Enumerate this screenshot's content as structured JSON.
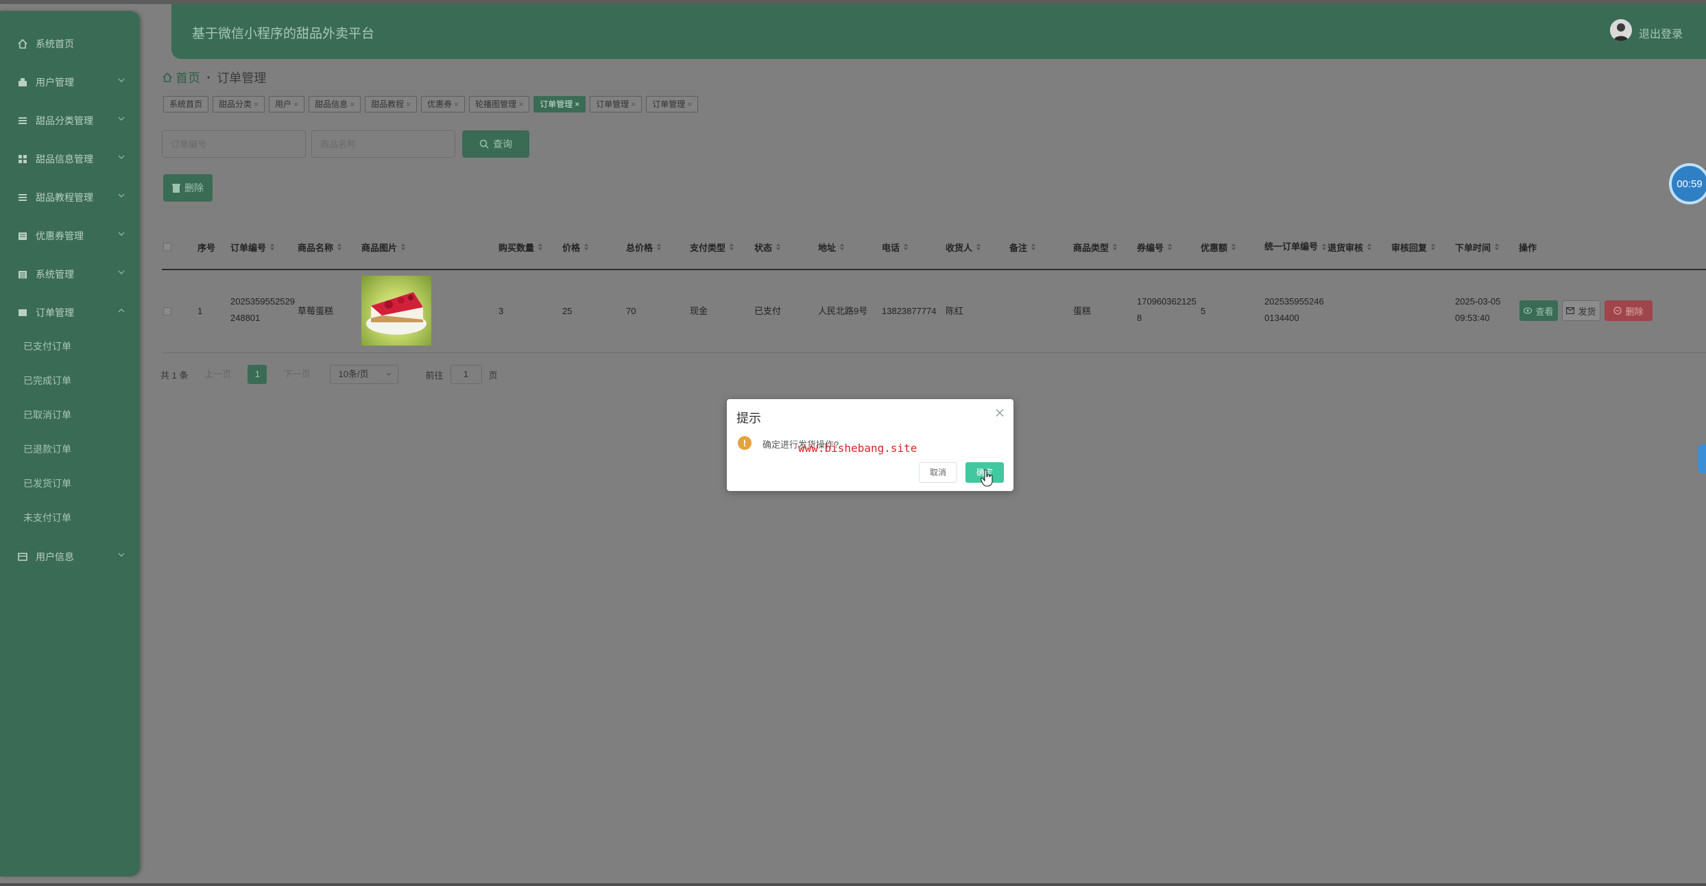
{
  "header": {
    "title": "基于微信小程序的甜品外卖平台",
    "logout": "退出登录"
  },
  "sidebar": {
    "items": [
      {
        "label": "系统首页",
        "icon": "home-icon"
      },
      {
        "label": "用户管理",
        "icon": "user-icon"
      },
      {
        "label": "甜品分类管理",
        "icon": "list-icon"
      },
      {
        "label": "甜品信息管理",
        "icon": "grid-icon"
      },
      {
        "label": "甜品教程管理",
        "icon": "list-icon"
      },
      {
        "label": "优惠券管理",
        "icon": "coupon-icon"
      },
      {
        "label": "系统管理",
        "icon": "settings-icon"
      },
      {
        "label": "订单管理",
        "icon": "order-icon"
      }
    ],
    "order_sub": [
      "已支付订单",
      "已完成订单",
      "已取消订单",
      "已退款订单",
      "已发货订单",
      "未支付订单"
    ],
    "last": {
      "label": "用户信息",
      "icon": "user-info-icon"
    }
  },
  "breadcrumb": {
    "home": "首页",
    "current": "订单管理"
  },
  "tabs": [
    {
      "label": "系统首页",
      "closable": false,
      "active": false
    },
    {
      "label": "甜品分类",
      "closable": true,
      "active": false
    },
    {
      "label": "用户",
      "closable": true,
      "active": false
    },
    {
      "label": "甜品信息",
      "closable": true,
      "active": false
    },
    {
      "label": "甜品教程",
      "closable": true,
      "active": false
    },
    {
      "label": "优惠券",
      "closable": true,
      "active": false
    },
    {
      "label": "轮播图管理",
      "closable": true,
      "active": false
    },
    {
      "label": "订单管理",
      "closable": true,
      "active": true
    },
    {
      "label": "订单管理",
      "closable": true,
      "active": false
    },
    {
      "label": "订单管理",
      "closable": true,
      "active": false
    }
  ],
  "search": {
    "order_placeholder": "订单编号",
    "name_placeholder": "商品名称",
    "query_label": "查询",
    "delete_label": "删除"
  },
  "timer": "00:59",
  "table": {
    "headers": {
      "index": "序号",
      "order_no": "订单编号",
      "name": "商品名称",
      "image": "商品图片",
      "qty": "购买数量",
      "price": "价格",
      "total": "总价格",
      "pay_type": "支付类型",
      "status": "状态",
      "address": "地址",
      "phone": "电话",
      "receiver": "收货人",
      "remark": "备注",
      "goods_type": "商品类型",
      "coupon_no": "券编号",
      "discount": "优惠额",
      "unified_no": "统一订单编号",
      "refund_review": "退货审核",
      "review_reply": "审核回复",
      "order_time": "下单时间",
      "actions": "操作"
    },
    "row": {
      "index": "1",
      "order_no": "2025359552529248801",
      "name": "草莓蛋糕",
      "qty": "3",
      "price": "25",
      "total": "70",
      "pay_type": "现金",
      "status": "已支付",
      "address": "人民北路9号",
      "phone": "13823877774",
      "receiver": "陈红",
      "goods_type": "蛋糕",
      "coupon_no": "1709603621258",
      "discount": "5",
      "unified_no": "2025359552460134400",
      "order_time": "2025-03-05 09:53:40",
      "btn_view": "查看",
      "btn_ship": "发货",
      "btn_delete": "删除"
    }
  },
  "pager": {
    "total": "共 1 条",
    "prev": "上一页",
    "page": "1",
    "next": "下一页",
    "size": "10条/页",
    "goto": "前往",
    "goto_value": "1",
    "page_unit": "页"
  },
  "dialog": {
    "title": "提示",
    "message": "确定进行发货操作?",
    "watermark": "www.bishebang.site",
    "cancel": "取消",
    "ok": "确定"
  }
}
